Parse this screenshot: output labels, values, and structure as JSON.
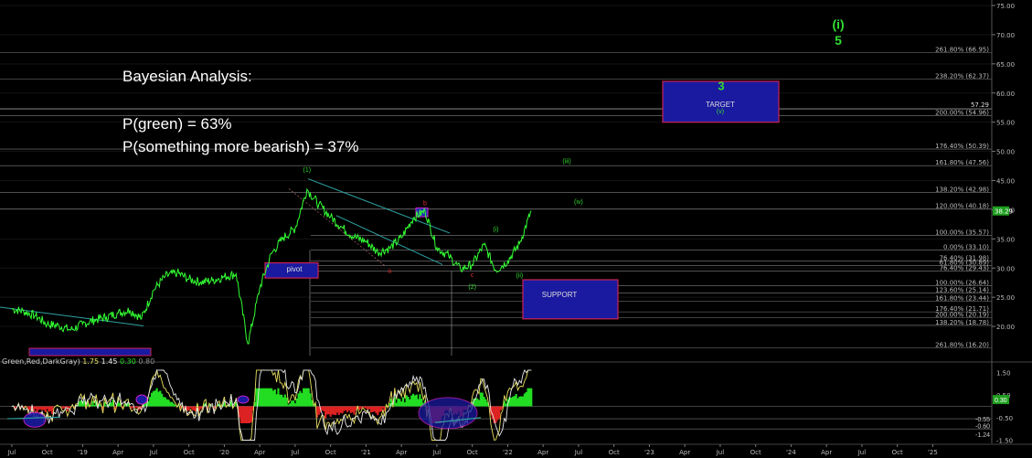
{
  "annotation": {
    "title": "Bayesian Analysis:",
    "line1": "P(green) = 63%",
    "line2": "P(something more bearish) = 37%"
  },
  "indicator_legend": {
    "name": "Green,Red,DarkGray)",
    "v1": "1.75",
    "v2": "1.45",
    "v3": "0.30",
    "v4": "0.80"
  },
  "colors": {
    "background": "#000000",
    "price": "#33ff33",
    "fib_line": "#a0a0a0",
    "target_box": "#1a1aa0",
    "target_border": "#cc2255",
    "support_box": "#1a1aa0",
    "wave_label": "#33dd33",
    "osc_yellow": "#e8e060",
    "osc_white": "#e8e8e8",
    "hist_green": "#22dd22",
    "hist_red": "#dd2222"
  },
  "chart_data": {
    "type": "line",
    "title": "",
    "ylim": [
      15,
      75
    ],
    "y_ticks": [
      "75.00",
      "70.00",
      "65.00",
      "60.00",
      "55.00",
      "50.00",
      "45.00",
      "40.00",
      "35.00",
      "30.00",
      "25.00",
      "20.00"
    ],
    "y_tick_values": [
      75,
      70,
      65,
      60,
      55,
      50,
      45,
      40,
      35,
      30,
      25,
      20
    ],
    "x_ticks": [
      "Jul",
      "Oct",
      "'19",
      "Apr",
      "Jul",
      "Oct",
      "'20",
      "Apr",
      "Jul",
      "Oct",
      "'21",
      "Apr",
      "Jul",
      "Oct",
      "'22",
      "Apr",
      "Jul",
      "Oct",
      "'23",
      "Apr",
      "Jul",
      "Oct",
      "'24",
      "Apr",
      "Jul",
      "Oct",
      "'25"
    ],
    "last_price": "38.29",
    "price_level_label": "57.29",
    "price_series": [
      {
        "date": "2018-07",
        "y": 23.0
      },
      {
        "date": "2018-08",
        "y": 22.6
      },
      {
        "date": "2018-09",
        "y": 21.8
      },
      {
        "date": "2018-10",
        "y": 20.4
      },
      {
        "date": "2018-11",
        "y": 20.1
      },
      {
        "date": "2018-12",
        "y": 19.4
      },
      {
        "date": "2019-01",
        "y": 20.4
      },
      {
        "date": "2019-02",
        "y": 21.1
      },
      {
        "date": "2019-03",
        "y": 21.6
      },
      {
        "date": "2019-04",
        "y": 22.3
      },
      {
        "date": "2019-05",
        "y": 22.8
      },
      {
        "date": "2019-06",
        "y": 21.4
      },
      {
        "date": "2019-07",
        "y": 26.2
      },
      {
        "date": "2019-08",
        "y": 28.6
      },
      {
        "date": "2019-09",
        "y": 29.2
      },
      {
        "date": "2019-10",
        "y": 28.1
      },
      {
        "date": "2019-11",
        "y": 27.6
      },
      {
        "date": "2019-12",
        "y": 27.9
      },
      {
        "date": "2020-01",
        "y": 28.5
      },
      {
        "date": "2020-02",
        "y": 29.0
      },
      {
        "date": "2020-03",
        "y": 17.0
      },
      {
        "date": "2020-04",
        "y": 26.6
      },
      {
        "date": "2020-05",
        "y": 32.5
      },
      {
        "date": "2020-06",
        "y": 35.2
      },
      {
        "date": "2020-07",
        "y": 36.8
      },
      {
        "date": "2020-08",
        "y": 43.5
      },
      {
        "date": "2020-09",
        "y": 40.9
      },
      {
        "date": "2020-10",
        "y": 38.8
      },
      {
        "date": "2020-11",
        "y": 36.9
      },
      {
        "date": "2020-12",
        "y": 35.3
      },
      {
        "date": "2021-01",
        "y": 34.6
      },
      {
        "date": "2021-02",
        "y": 32.7
      },
      {
        "date": "2021-03",
        "y": 33.4
      },
      {
        "date": "2021-04",
        "y": 35.2
      },
      {
        "date": "2021-05",
        "y": 38.6
      },
      {
        "date": "2021-06",
        "y": 39.8
      },
      {
        "date": "2021-07",
        "y": 33.5
      },
      {
        "date": "2021-08",
        "y": 32.1
      },
      {
        "date": "2021-09",
        "y": 29.8
      },
      {
        "date": "2021-10",
        "y": 30.6
      },
      {
        "date": "2021-11",
        "y": 34.0
      },
      {
        "date": "2021-12",
        "y": 29.6
      },
      {
        "date": "2022-01",
        "y": 31.2
      },
      {
        "date": "2022-02",
        "y": 34.2
      },
      {
        "date": "2022-03",
        "y": 39.8
      }
    ],
    "fib_levels": [
      {
        "label": "261.80% (66.95)",
        "y": 66.95
      },
      {
        "label": "238.20% (62.37)",
        "y": 62.37
      },
      {
        "label": "200.00% (54.96)",
        "y": 56.1
      },
      {
        "label": "176.40% (50.39)",
        "y": 50.39
      },
      {
        "label": "161.80% (47.56)",
        "y": 47.56
      },
      {
        "label": "138.20% (42.98)",
        "y": 42.98
      },
      {
        "label": "120.00% (40.18)",
        "y": 40.18
      },
      {
        "label": "100.00% (35.57)",
        "y": 35.57
      },
      {
        "label": "0.00% (33.10)",
        "y": 33.1
      },
      {
        "label": "76.40% (31.98)",
        "y": 31.2
      },
      {
        "label": "61.80% (30.89)",
        "y": 30.4
      },
      {
        "label": "76.40% (29.43)",
        "y": 29.5
      },
      {
        "label": "100.00% (26.64)",
        "y": 27.0
      },
      {
        "label": "123.60% (25.14)",
        "y": 25.7
      },
      {
        "label": "161.80% (23.44)",
        "y": 24.3
      },
      {
        "label": "176.40% (21.71)",
        "y": 22.5
      },
      {
        "label": "200.00% (20.19)",
        "y": 21.5
      },
      {
        "label": "138.20% (18.78)",
        "y": 20.2
      },
      {
        "label": "261.80% (16.20)",
        "y": 16.35
      }
    ],
    "boxes": [
      {
        "label": "3",
        "sublabel": "TARGET",
        "subsublabel": "(v)"
      },
      {
        "label": "SUPPORT"
      },
      {
        "label": "pivot"
      }
    ],
    "wave_labels": [
      {
        "text": "(i)",
        "date": "2024-05",
        "y": 71.0,
        "big": true
      },
      {
        "text": "5",
        "date": "2024-05",
        "y": 68.3,
        "big": true
      },
      {
        "text": "(1)",
        "date": "2020-08",
        "y": 46.5
      },
      {
        "text": "(iii)",
        "date": "2022-06",
        "y": 48.0
      },
      {
        "text": "(iv)",
        "date": "2022-07",
        "y": 41.0
      },
      {
        "text": "b",
        "date": "2021-06",
        "y": 40.8,
        "red": true
      },
      {
        "text": "a",
        "date": "2021-03",
        "y": 29.2,
        "red": true
      },
      {
        "text": "c",
        "date": "2021-10",
        "y": 28.5,
        "red": true
      },
      {
        "text": "(2)",
        "date": "2021-10",
        "y": 26.4
      },
      {
        "text": "(i)",
        "date": "2021-12",
        "y": 36.3
      },
      {
        "text": "(ii)",
        "date": "2022-02",
        "y": 28.4
      }
    ],
    "oscillator": {
      "ylim": [
        -1.6,
        1.8
      ],
      "y_ticks": [
        "1.50",
        "0.50",
        "-0.50",
        "-1.50"
      ],
      "y_tick_values": [
        1.5,
        0.5,
        -0.5,
        -1.5
      ],
      "value_labels": [
        "0.30",
        "-0.55",
        "-0.60",
        "-1.24"
      ]
    }
  }
}
